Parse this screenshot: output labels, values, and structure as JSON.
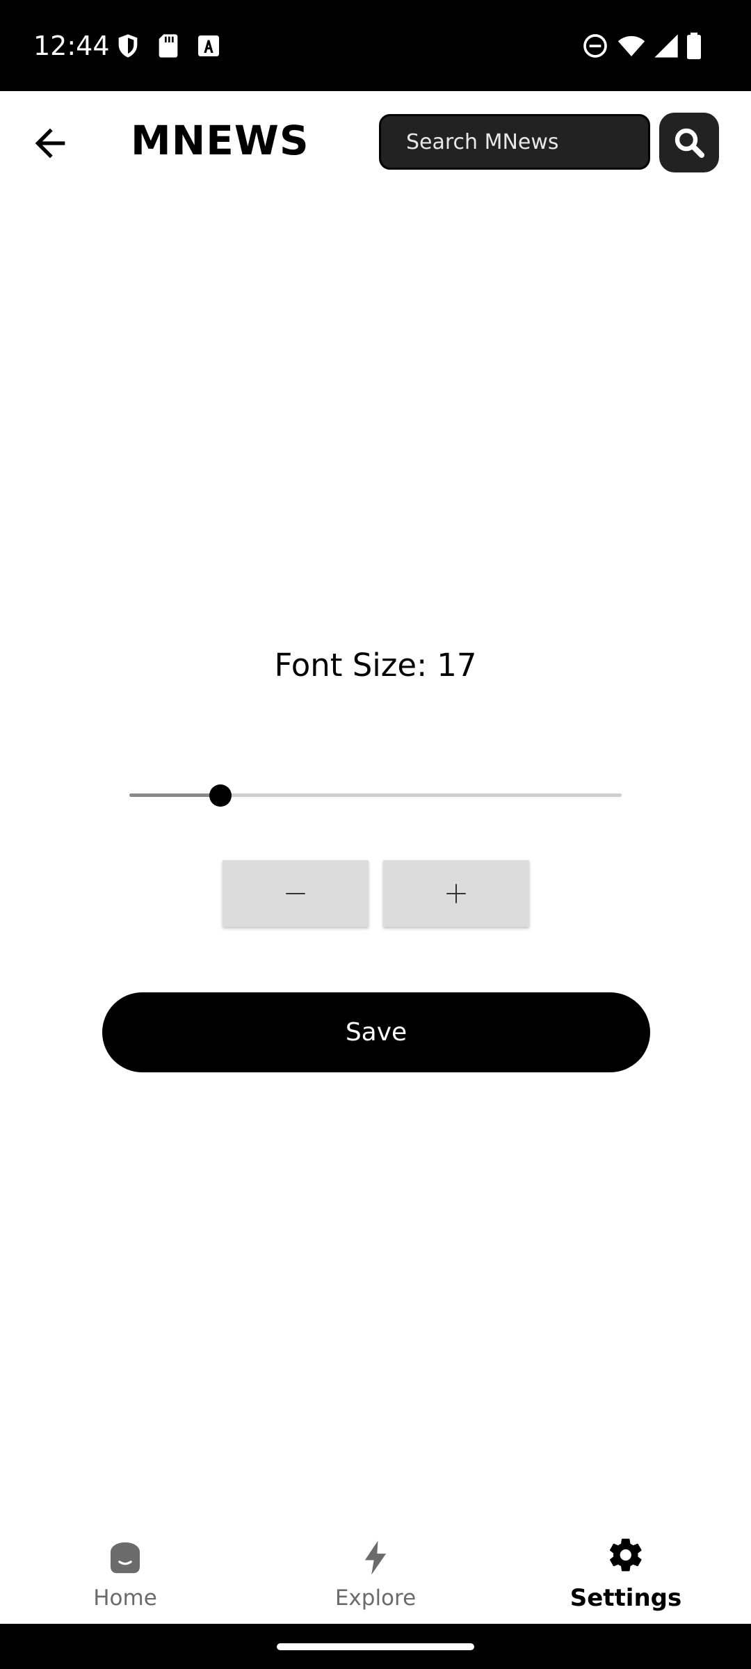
{
  "status_bar": {
    "time": "12:44",
    "left_icons": [
      "shield-icon",
      "sd-card-icon",
      "font-a-icon"
    ],
    "right_icons": [
      "do-not-disturb-icon",
      "wifi-icon",
      "signal-icon",
      "battery-icon"
    ]
  },
  "header": {
    "back_icon": "arrow-left-icon",
    "logo_text": "MNEWS",
    "search": {
      "placeholder": "Search MNews",
      "value": ""
    },
    "search_button_icon": "search-icon"
  },
  "font_settings": {
    "label": "Font Size:",
    "value": "17",
    "slider_fraction": 0.185,
    "decrease_icon": "minus-icon",
    "increase_icon": "plus-icon",
    "save_label": "Save"
  },
  "bottom_nav": {
    "items": [
      {
        "label": "Home",
        "icon": "home-icon",
        "active": false
      },
      {
        "label": "Explore",
        "icon": "lightning-icon",
        "active": false
      },
      {
        "label": "Settings",
        "icon": "gear-icon",
        "active": true
      }
    ]
  },
  "colors": {
    "accent": "#000000",
    "search_bg": "#222222",
    "step_button_bg": "#dcdcdc",
    "inactive_nav": "#6b6b6b"
  }
}
